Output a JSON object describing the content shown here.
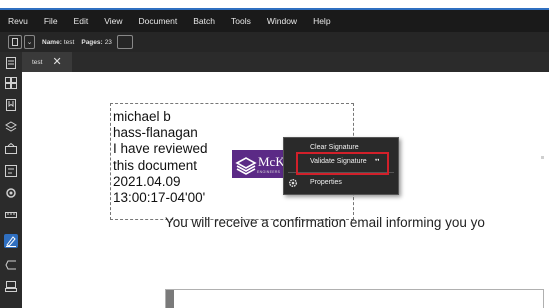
{
  "menubar": {
    "items": [
      "Revu",
      "File",
      "Edit",
      "View",
      "Document",
      "Batch",
      "Tools",
      "Window",
      "Help"
    ]
  },
  "propbar": {
    "name_label": "Name:",
    "name_value": "test",
    "pages_label": "Pages:",
    "pages_value": "23"
  },
  "tabs": [
    {
      "label": "test",
      "close": "✕"
    }
  ],
  "sidebar": {
    "icons": [
      "thumbnails-icon",
      "pages-icon",
      "bookmarks-icon",
      "layers-icon",
      "signatures-icon",
      "form-icon",
      "settings-icon",
      "measure-icon",
      "markup-list-icon",
      "links-icon",
      "stamp-icon"
    ]
  },
  "signature": {
    "lines": [
      "michael b",
      "hass-flanagan",
      "I have reviewed",
      "this document",
      "2021.04.09",
      "13:00:17-04'00'"
    ],
    "logo_text": "McK",
    "logo_subtext": "ENGINEERS"
  },
  "document": {
    "body_line": "You will receive a confirmation email informing you yo"
  },
  "context_menu": {
    "items": [
      "Clear Signature",
      "Validate Signature",
      "Properties"
    ]
  },
  "colors": {
    "highlight": "#d2202a",
    "logo": "#5b2a86",
    "menubar_accent": "#2f6fc0"
  }
}
